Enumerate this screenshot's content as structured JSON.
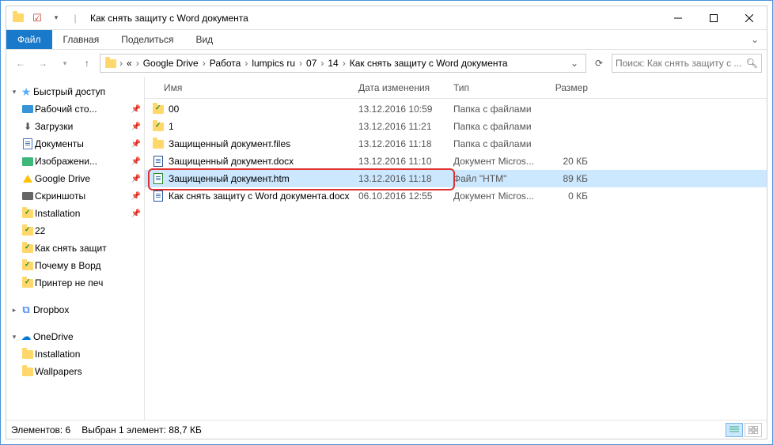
{
  "window": {
    "title": "Как снять защиту с Word документа"
  },
  "ribbon": {
    "file": "Файл",
    "home": "Главная",
    "share": "Поделиться",
    "view": "Вид"
  },
  "breadcrumb": {
    "ellipsis": "«",
    "items": [
      "Google Drive",
      "Работа",
      "lumpics ru",
      "07",
      "14",
      "Как снять защиту с Word документа"
    ]
  },
  "search": {
    "placeholder": "Поиск: Как снять защиту с ..."
  },
  "sidebar": {
    "quick": {
      "label": "Быстрый доступ",
      "items": [
        {
          "icon": "desktop",
          "label": "Рабочий сто...",
          "pinned": true
        },
        {
          "icon": "downloads",
          "label": "Загрузки",
          "pinned": true
        },
        {
          "icon": "documents",
          "label": "Документы",
          "pinned": true
        },
        {
          "icon": "pictures",
          "label": "Изображени...",
          "pinned": true
        },
        {
          "icon": "gdrive",
          "label": "Google Drive",
          "pinned": true
        },
        {
          "icon": "camera",
          "label": "Скриншоты",
          "pinned": true
        },
        {
          "icon": "folder-check",
          "label": "Installation",
          "pinned": true
        },
        {
          "icon": "folder-check",
          "label": "22",
          "pinned": false
        },
        {
          "icon": "folder-check",
          "label": "Как снять защит",
          "pinned": false
        },
        {
          "icon": "folder-check",
          "label": "Почему в Ворд",
          "pinned": false
        },
        {
          "icon": "folder-check",
          "label": "Принтер не печ",
          "pinned": false
        }
      ]
    },
    "dropbox": {
      "label": "Dropbox"
    },
    "onedrive": {
      "label": "OneDrive",
      "items": [
        {
          "icon": "folder",
          "label": "Installation"
        },
        {
          "icon": "folder",
          "label": "Wallpapers"
        }
      ]
    }
  },
  "columns": {
    "name": "Имя",
    "date": "Дата изменения",
    "type": "Тип",
    "size": "Размер"
  },
  "files": [
    {
      "icon": "folder-check",
      "name": "00",
      "date": "13.12.2016 10:59",
      "type": "Папка с файлами",
      "size": "",
      "selected": false
    },
    {
      "icon": "folder-check",
      "name": "1",
      "date": "13.12.2016 11:21",
      "type": "Папка с файлами",
      "size": "",
      "selected": false
    },
    {
      "icon": "folder",
      "name": "Защищенный документ.files",
      "date": "13.12.2016 11:18",
      "type": "Папка с файлами",
      "size": "",
      "selected": false
    },
    {
      "icon": "word",
      "name": "Защищенный документ.docx",
      "date": "13.12.2016 11:10",
      "type": "Документ Micros...",
      "size": "20 КБ",
      "selected": false
    },
    {
      "icon": "htm",
      "name": "Защищенный документ.htm",
      "date": "13.12.2016 11:18",
      "type": "Файл \"HTM\"",
      "size": "89 КБ",
      "selected": true,
      "highlight": true
    },
    {
      "icon": "word",
      "name": "Как снять защиту с Word документа.docx",
      "date": "06.10.2016 12:55",
      "type": "Документ Micros...",
      "size": "0 КБ",
      "selected": false
    }
  ],
  "status": {
    "count_label": "Элементов: 6",
    "selection_label": "Выбран 1 элемент: 88,7 КБ"
  }
}
